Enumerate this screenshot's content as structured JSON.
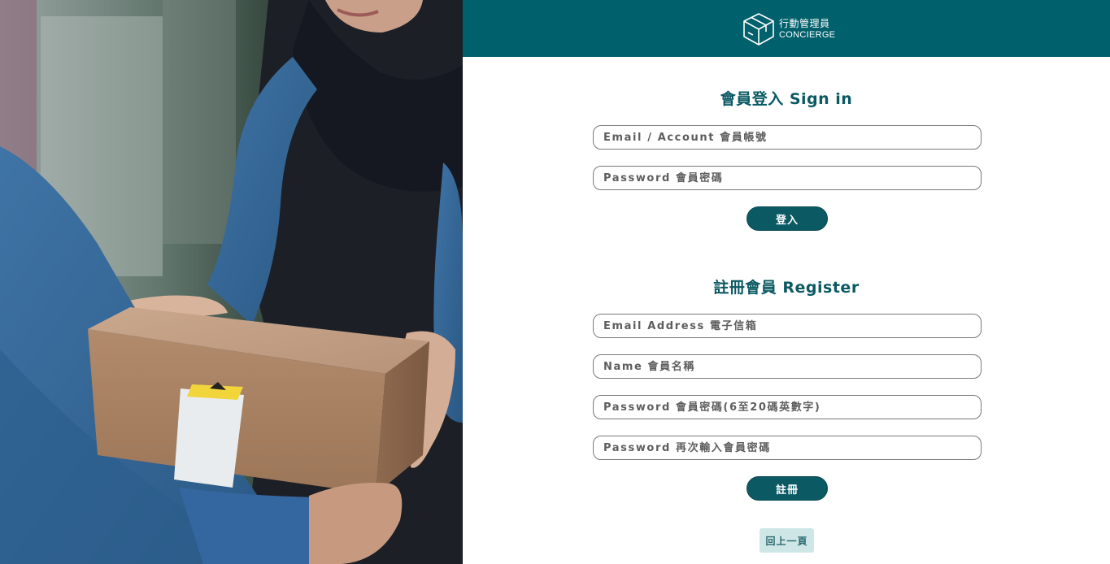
{
  "header": {
    "logo_cn": "行動管理員",
    "logo_en": "CONCIERGE",
    "brand_color": "#00606b",
    "logo_icon": "package-box-icon"
  },
  "hero_image": {
    "icon": "delivery-photo"
  },
  "signin": {
    "title": "會員登入 Sign in",
    "email_placeholder": "Email / Account 會員帳號",
    "password_placeholder": "Password 會員密碼",
    "submit_label": "登入"
  },
  "register": {
    "title": "註冊會員 Register",
    "email_placeholder": "Email Address 電子信箱",
    "name_placeholder": "Name 會員名稱",
    "password_placeholder": "Password 會員密碼(6至20碼英數字)",
    "confirm_placeholder": "Password 再次輸入會員密碼",
    "submit_label": "註冊"
  },
  "back_label": "回上一頁",
  "colors": {
    "accent": "#0a5963",
    "back_button_bg": "#cfe6e6"
  }
}
